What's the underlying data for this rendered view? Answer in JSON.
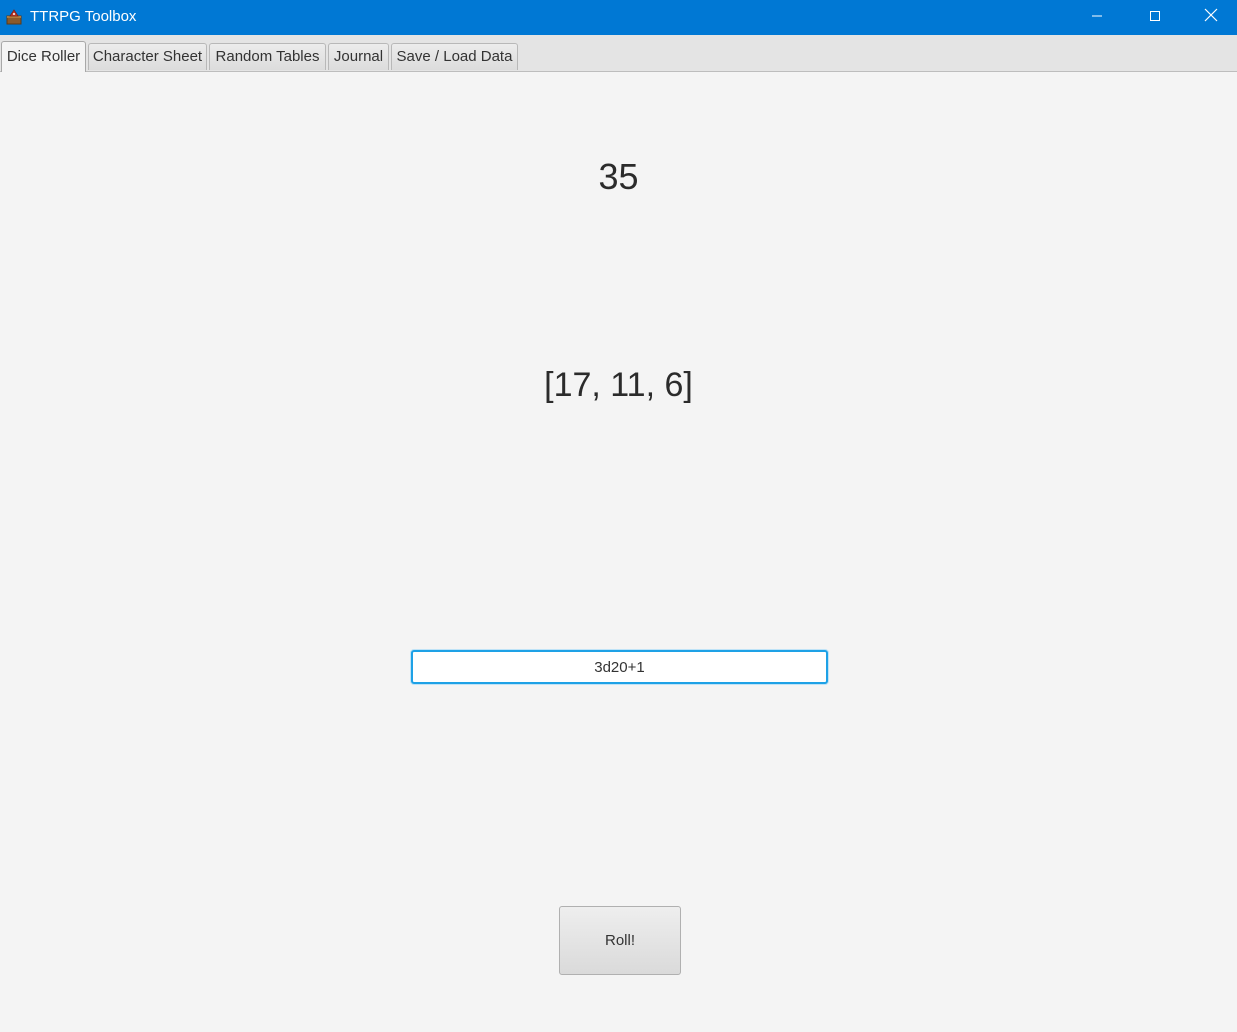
{
  "window": {
    "title": "TTRPG Toolbox",
    "app_icon": "dice-chest-icon",
    "controls": [
      "minimize-icon",
      "maximize-icon",
      "close-icon"
    ],
    "accent_color": "#0078d4"
  },
  "tabs": [
    {
      "label": "Dice Roller",
      "active": true
    },
    {
      "label": "Character Sheet",
      "active": false
    },
    {
      "label": "Random Tables",
      "active": false
    },
    {
      "label": "Journal",
      "active": false
    },
    {
      "label": "Save / Load Data",
      "active": false
    }
  ],
  "dice_roller": {
    "total": "35",
    "rolls": "[17, 11, 6]",
    "input_value": "3d20+1",
    "roll_button_label": "Roll!",
    "input_focus_color": "#1ea1e6"
  }
}
